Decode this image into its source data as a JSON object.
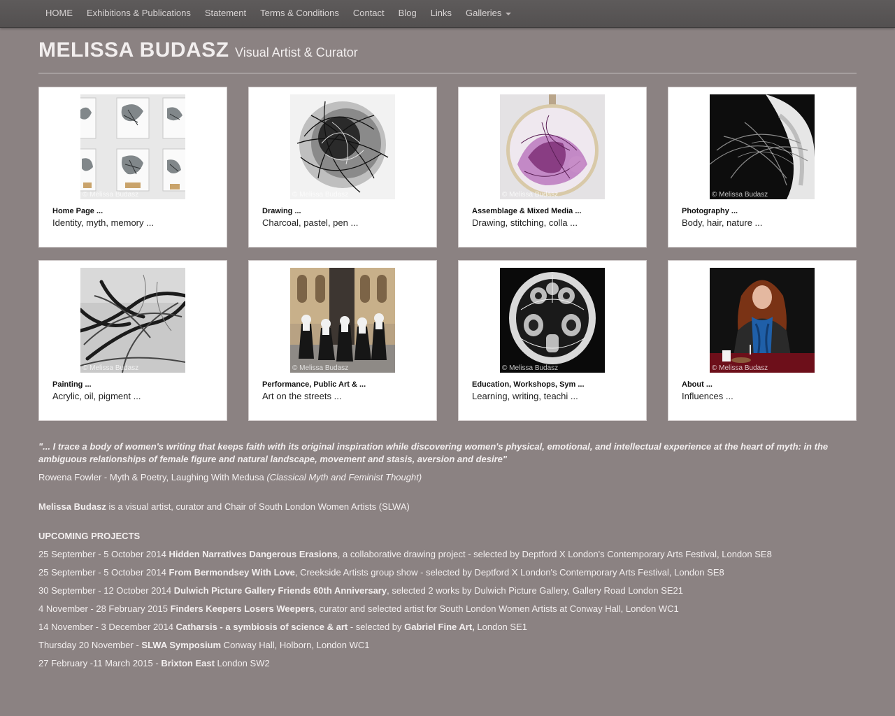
{
  "nav": {
    "items": [
      "HOME",
      "Exhibitions & Publications",
      "Statement",
      "Terms & Conditions",
      "Contact",
      "Blog",
      "Links",
      "Galleries"
    ]
  },
  "header": {
    "name": "MELISSA BUDASZ",
    "tagline": "Visual Artist & Curator"
  },
  "gallery": [
    {
      "title": "Home Page ...",
      "subtitle": "Identity, myth, memory ...",
      "watermark": "© Melissa Budasz"
    },
    {
      "title": "Drawing ...",
      "subtitle": "Charcoal, pastel, pen ...",
      "watermark": "© Melissa Budasz"
    },
    {
      "title": "Assemblage & Mixed Media ...",
      "subtitle": "Drawing, stitching, colla ...",
      "watermark": "© Melissa Budasz"
    },
    {
      "title": "Photography ...",
      "subtitle": "Body, hair, nature ...",
      "watermark": "© Melissa Budasz"
    },
    {
      "title": "Painting ...",
      "subtitle": "Acrylic, oil, pigment ...",
      "watermark": "© Melissa Budasz"
    },
    {
      "title": "Performance, Public Art & ...",
      "subtitle": "Art on the streets ...",
      "watermark": "© Melissa Budasz"
    },
    {
      "title": "Education, Workshops, Sym ...",
      "subtitle": "Learning, writing, teachi ...",
      "watermark": "© Melissa Budasz"
    },
    {
      "title": "About ...",
      "subtitle": "Influences ...",
      "watermark": "© Melissa Budasz"
    }
  ],
  "quote": {
    "text": "\"... I trace a body of women's writing that keeps faith with its original inspiration while discovering women's physical, emotional, and intellectual experience at the heart of myth: in the ambiguous relationships of female figure and natural landscape, movement and stasis, aversion and desire\"",
    "attribution": "Rowena Fowler - Myth & Poetry, Laughing With Medusa ",
    "source": "(Classical Myth and Feminist Thought)"
  },
  "bio": {
    "name": "Melissa Budasz",
    "text": " is a visual artist, curator and Chair of South London Women Artists (SLWA)"
  },
  "upcoming": {
    "heading": "UPCOMING PROJECTS",
    "projects": [
      {
        "date": "25 September - 5 October 2014 ",
        "title": "Hidden Narratives Dangerous Erasions",
        "detail": ", a collaborative drawing project - selected by Deptford X London's Contemporary Arts Festival, London SE8"
      },
      {
        "date": "25 September - 5 October 2014 ",
        "title": "From Bermondsey With Love",
        "detail": ", Creekside Artists group show - selected by Deptford X London's Contemporary Arts Festival, London SE8"
      },
      {
        "date": "30 September - 12 October 2014 ",
        "title": "Dulwich Picture Gallery Friends 60th Anniversary",
        "detail": ", selected 2 works by Dulwich Picture Gallery, Gallery Road London SE21"
      },
      {
        "date": "4 November - 28 February 2015 ",
        "title": "Finders Keepers Losers Weepers",
        "detail": ", curator and selected artist for South London Women Artists at Conway Hall, London WC1"
      },
      {
        "date": "14 November - 3 December 2014 ",
        "title": "Catharsis - a symbiosis of science & art",
        "detail": " - selected by ",
        "title2": "Gabriel Fine Art,",
        "detail2": " London SE1"
      },
      {
        "date": "Thursday 20 November - ",
        "title": "SLWA Symposium",
        "detail": " Conway Hall, Holborn, London WC1"
      },
      {
        "date": "27 February -11 March 2015 - ",
        "title": "Brixton East",
        "detail": " London SW2"
      }
    ]
  }
}
